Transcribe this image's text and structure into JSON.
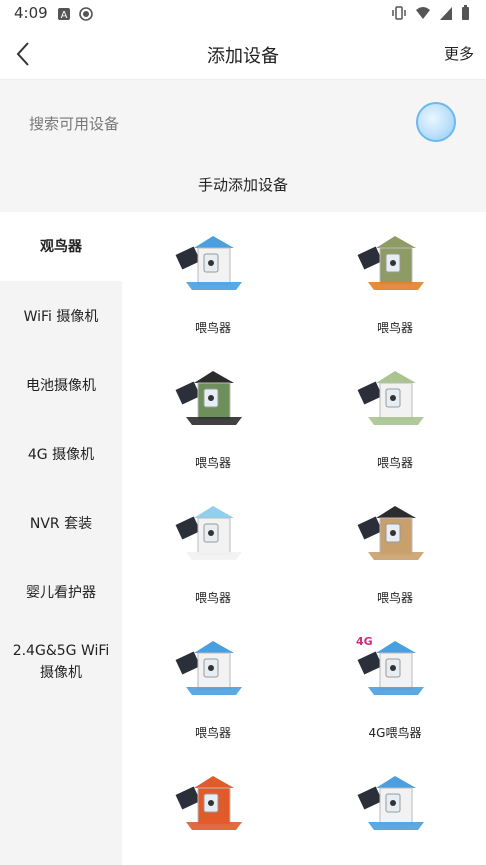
{
  "status": {
    "time": "4:09"
  },
  "header": {
    "title": "添加设备",
    "more": "更多"
  },
  "search": {
    "label": "搜索可用设备",
    "manual_add": "手动添加设备"
  },
  "sidebar": {
    "items": [
      {
        "label": "观鸟器",
        "active": true
      },
      {
        "label": "WiFi 摄像机"
      },
      {
        "label": "电池摄像机"
      },
      {
        "label": "4G 摄像机"
      },
      {
        "label": "NVR 套装"
      },
      {
        "label": "婴儿看护器"
      },
      {
        "label": "2.4G&5G WiFi 摄像机"
      }
    ]
  },
  "devices": [
    {
      "label": "喂鸟器",
      "roof": "#4a9fe0",
      "body": "#f2f2f2",
      "tray": "#4a9fe0"
    },
    {
      "label": "喂鸟器",
      "roof": "#8f9b64",
      "body": "#8f9b64",
      "tray": "#e0822a"
    },
    {
      "label": "喂鸟器",
      "roof": "#2c2c2c",
      "body": "#6d8f5a",
      "tray": "#2c2c2c"
    },
    {
      "label": "喂鸟器",
      "roof": "#a9c48e",
      "body": "#f2f2f2",
      "tray": "#a9c48e"
    },
    {
      "label": "喂鸟器",
      "roof": "#8fd0ee",
      "body": "#f2f2f2",
      "tray": "#f2f2f2"
    },
    {
      "label": "喂鸟器",
      "roof": "#2c2c2c",
      "body": "#c9a06b",
      "tray": "#c9a06b"
    },
    {
      "label": "喂鸟器",
      "roof": "#4a9fe0",
      "body": "#f2f2f2",
      "tray": "#4a9fe0"
    },
    {
      "label": "4G喂鸟器",
      "roof": "#4a9fe0",
      "body": "#f2f2f2",
      "tray": "#4a9fe0",
      "badge": "4G"
    },
    {
      "label": "",
      "roof": "#e05a2a",
      "body": "#e05a2a",
      "tray": "#e05a2a"
    },
    {
      "label": "",
      "roof": "#4a9fe0",
      "body": "#f2f2f2",
      "tray": "#4a9fe0"
    }
  ]
}
